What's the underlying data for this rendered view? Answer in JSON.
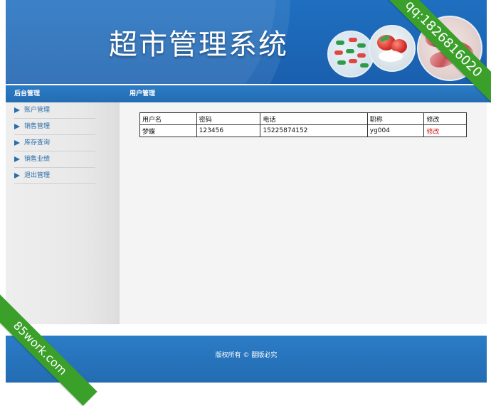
{
  "header": {
    "title": "超市管理系统"
  },
  "sidebar": {
    "title": "后台管理",
    "items": [
      {
        "label": "账户管理"
      },
      {
        "label": "销售管理"
      },
      {
        "label": "库存查询"
      },
      {
        "label": "销售业绩"
      },
      {
        "label": "退出管理"
      }
    ]
  },
  "main": {
    "title": "用户管理",
    "table": {
      "headers": [
        "用户名",
        "密码",
        "电话",
        "职称",
        "修改"
      ],
      "rows": [
        {
          "username": "梦蝶",
          "password": "123456",
          "phone": "15225874152",
          "title": "yg004",
          "action": "修改"
        }
      ]
    }
  },
  "footer": {
    "text": "版权所有 © 翻版必究"
  },
  "watermarks": {
    "top_right": "qq:1826816020",
    "bottom_left": "85work.com"
  },
  "colors": {
    "brand_blue": "#236cb2",
    "ribbon_green": "#3aa02a",
    "link_red": "#d11b1b"
  }
}
